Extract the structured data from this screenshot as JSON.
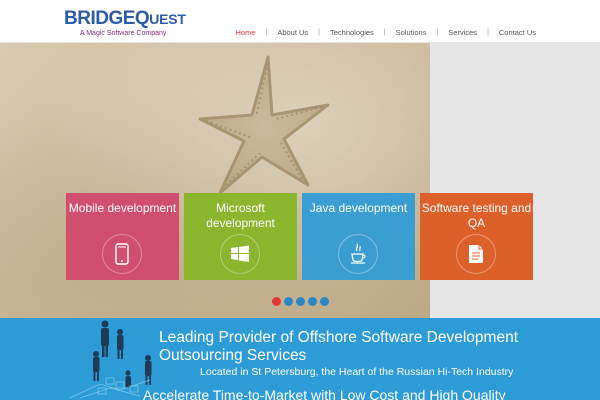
{
  "brand": {
    "logo_text_big": "BRIDGEQ",
    "logo_text_small": "UEST",
    "tagline": "A Magic Software Company",
    "primary_color": "#2c5ca8",
    "accent_color": "#8c2a86"
  },
  "nav": {
    "items": [
      {
        "label": "Home",
        "active": true
      },
      {
        "label": "About Us"
      },
      {
        "label": "Technologies"
      },
      {
        "label": "Solutions"
      },
      {
        "label": "Services"
      },
      {
        "label": "Contact Us"
      }
    ],
    "active_color": "#e3373d"
  },
  "hero": {
    "tiles": [
      {
        "title": "Mobile development",
        "icon": "mobile-phone-icon",
        "color": "#d04e6e"
      },
      {
        "title": "Microsoft development",
        "icon": "windows-logo-icon",
        "color": "#8db62f"
      },
      {
        "title": "Java development",
        "icon": "java-cup-icon",
        "color": "#3b9ed3"
      },
      {
        "title": "Software testing and QA",
        "icon": "document-icon",
        "color": "#dc602a"
      }
    ],
    "slider_dots": 5,
    "active_dot": 1
  },
  "band": {
    "headline": "Leading Provider of Offshore Software Development Outsourcing Services",
    "subline": "Located in St Petersburg, the Heart of the Russian Hi-Tech Industry",
    "next_line": "Accelerate Time-to-Market with Low Cost and High Quality",
    "color": "#2c9bd6"
  }
}
